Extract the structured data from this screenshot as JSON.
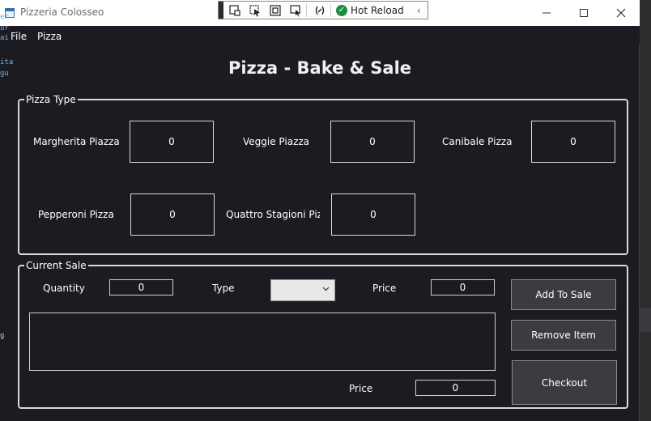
{
  "window": {
    "title": "Pizzeria Colosseo"
  },
  "debug_toolbar": {
    "hot_reload_label": "Hot Reload"
  },
  "menu": {
    "file": "File",
    "pizza": "Pizza"
  },
  "heading": "Pizza - Bake & Sale",
  "pizza_type": {
    "label": "Pizza Type",
    "items": [
      {
        "name": "Margherita Piazza",
        "count": "0"
      },
      {
        "name": "Veggie Piazza",
        "count": "0"
      },
      {
        "name": "Canibale Pizza",
        "count": "0"
      },
      {
        "name": "Pepperoni Pizza",
        "count": "0"
      },
      {
        "name": "Quattro Stagioni Pizza",
        "count": "0"
      }
    ]
  },
  "current_sale": {
    "label": "Current Sale",
    "quantity_label": "Quantity",
    "quantity_value": "0",
    "type_label": "Type",
    "type_value": "",
    "price_label": "Price",
    "price_value": "0",
    "total_price_label": "Price",
    "total_price_value": "0",
    "add_button": "Add To Sale",
    "remove_button": "Remove Item",
    "checkout_button": "Checkout"
  },
  "background_fragments": [
    "er",
    "ur",
    "ai",
    "ita",
    "gu",
    "g"
  ]
}
